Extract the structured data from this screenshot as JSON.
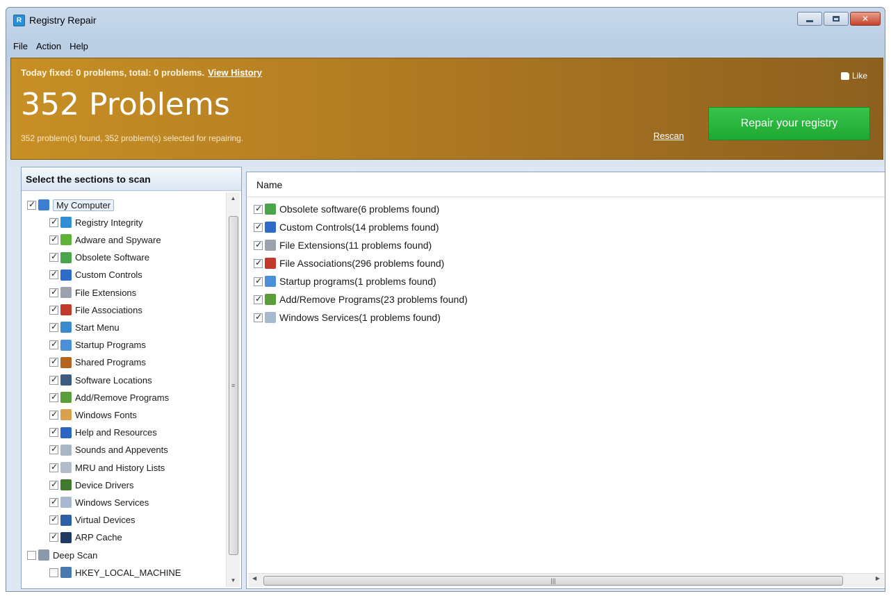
{
  "window": {
    "title": "Registry Repair"
  },
  "menu": [
    "File",
    "Action",
    "Help"
  ],
  "banner": {
    "today": "Today fixed: 0 problems, total: 0 problems.",
    "view_history": "View History",
    "headline": "352 Problems",
    "subtext": "352 problem(s) found, 352 problem(s) selected for repairing.",
    "rescan": "Rescan",
    "repair_button": "Repair your registry",
    "like": "Like"
  },
  "left": {
    "header": "Select the sections to scan",
    "tree": [
      {
        "label": "My Computer",
        "checked": true,
        "level": 0,
        "icon": "computer-icon",
        "color": "#3b7fd4"
      },
      {
        "label": "Registry Integrity",
        "checked": true,
        "level": 1,
        "icon": "registry-integrity-icon",
        "color": "#2f8fd8"
      },
      {
        "label": "Adware and Spyware",
        "checked": true,
        "level": 1,
        "icon": "adware-icon",
        "color": "#5db334"
      },
      {
        "label": "Obsolete Software",
        "checked": true,
        "level": 1,
        "icon": "trash-icon",
        "color": "#4aa64a"
      },
      {
        "label": "Custom Controls",
        "checked": true,
        "level": 1,
        "icon": "controls-icon",
        "color": "#2b6dc8"
      },
      {
        "label": "File Extensions",
        "checked": true,
        "level": 1,
        "icon": "file-extension-icon",
        "color": "#9aa3ad"
      },
      {
        "label": "File Associations",
        "checked": true,
        "level": 1,
        "icon": "file-association-icon",
        "color": "#c0392b"
      },
      {
        "label": "Start Menu",
        "checked": true,
        "level": 1,
        "icon": "start-menu-icon",
        "color": "#3a8ad0"
      },
      {
        "label": "Startup Programs",
        "checked": true,
        "level": 1,
        "icon": "startup-icon",
        "color": "#4a90d9"
      },
      {
        "label": "Shared Programs",
        "checked": true,
        "level": 1,
        "icon": "shared-icon",
        "color": "#b5651d"
      },
      {
        "label": "Software Locations",
        "checked": true,
        "level": 1,
        "icon": "software-location-icon",
        "color": "#3d5a80"
      },
      {
        "label": "Add/Remove Programs",
        "checked": true,
        "level": 1,
        "icon": "add-remove-icon",
        "color": "#5a9e3a"
      },
      {
        "label": "Windows Fonts",
        "checked": true,
        "level": 1,
        "icon": "fonts-icon",
        "color": "#d9a24a"
      },
      {
        "label": "Help and Resources",
        "checked": true,
        "level": 1,
        "icon": "help-icon",
        "color": "#2c64c4"
      },
      {
        "label": "Sounds and Appevents",
        "checked": true,
        "level": 1,
        "icon": "sound-icon",
        "color": "#a9b6c4"
      },
      {
        "label": "MRU and History Lists",
        "checked": true,
        "level": 1,
        "icon": "history-icon",
        "color": "#b0bccb"
      },
      {
        "label": "Device Drivers",
        "checked": true,
        "level": 1,
        "icon": "driver-icon",
        "color": "#3f7a2e"
      },
      {
        "label": "Windows Services",
        "checked": true,
        "level": 1,
        "icon": "services-icon",
        "color": "#a7b9cf"
      },
      {
        "label": "Virtual Devices",
        "checked": true,
        "level": 1,
        "icon": "virtual-device-icon",
        "color": "#2d5fa8"
      },
      {
        "label": "ARP Cache",
        "checked": true,
        "level": 1,
        "icon": "arp-icon",
        "color": "#1f3b63"
      },
      {
        "label": "Deep Scan",
        "checked": false,
        "level": 0,
        "icon": "deep-scan-icon",
        "color": "#8a9aad"
      },
      {
        "label": "HKEY_LOCAL_MACHINE",
        "checked": false,
        "level": 1,
        "icon": "hive-icon",
        "color": "#4a78b0"
      }
    ]
  },
  "right": {
    "header": "Name",
    "rows": [
      {
        "label": "Obsolete software(6 problems found)",
        "checked": true,
        "icon": "trash-icon",
        "color": "#4aa64a"
      },
      {
        "label": "Custom Controls(14 problems found)",
        "checked": true,
        "icon": "controls-icon",
        "color": "#2b6dc8"
      },
      {
        "label": "File Extensions(11 problems found)",
        "checked": true,
        "icon": "file-extension-icon",
        "color": "#9aa3ad"
      },
      {
        "label": "File Associations(296 problems found)",
        "checked": true,
        "icon": "file-association-icon",
        "color": "#c0392b"
      },
      {
        "label": "Startup programs(1 problems found)",
        "checked": true,
        "icon": "startup-icon",
        "color": "#4a90d9"
      },
      {
        "label": "Add/Remove Programs(23 problems found)",
        "checked": true,
        "icon": "add-remove-icon",
        "color": "#5a9e3a"
      },
      {
        "label": "Windows Services(1 problems found)",
        "checked": true,
        "icon": "services-icon",
        "color": "#a7b9cf"
      }
    ]
  },
  "colors": {
    "banner": "#b07a22",
    "repair": "#28b43c"
  }
}
